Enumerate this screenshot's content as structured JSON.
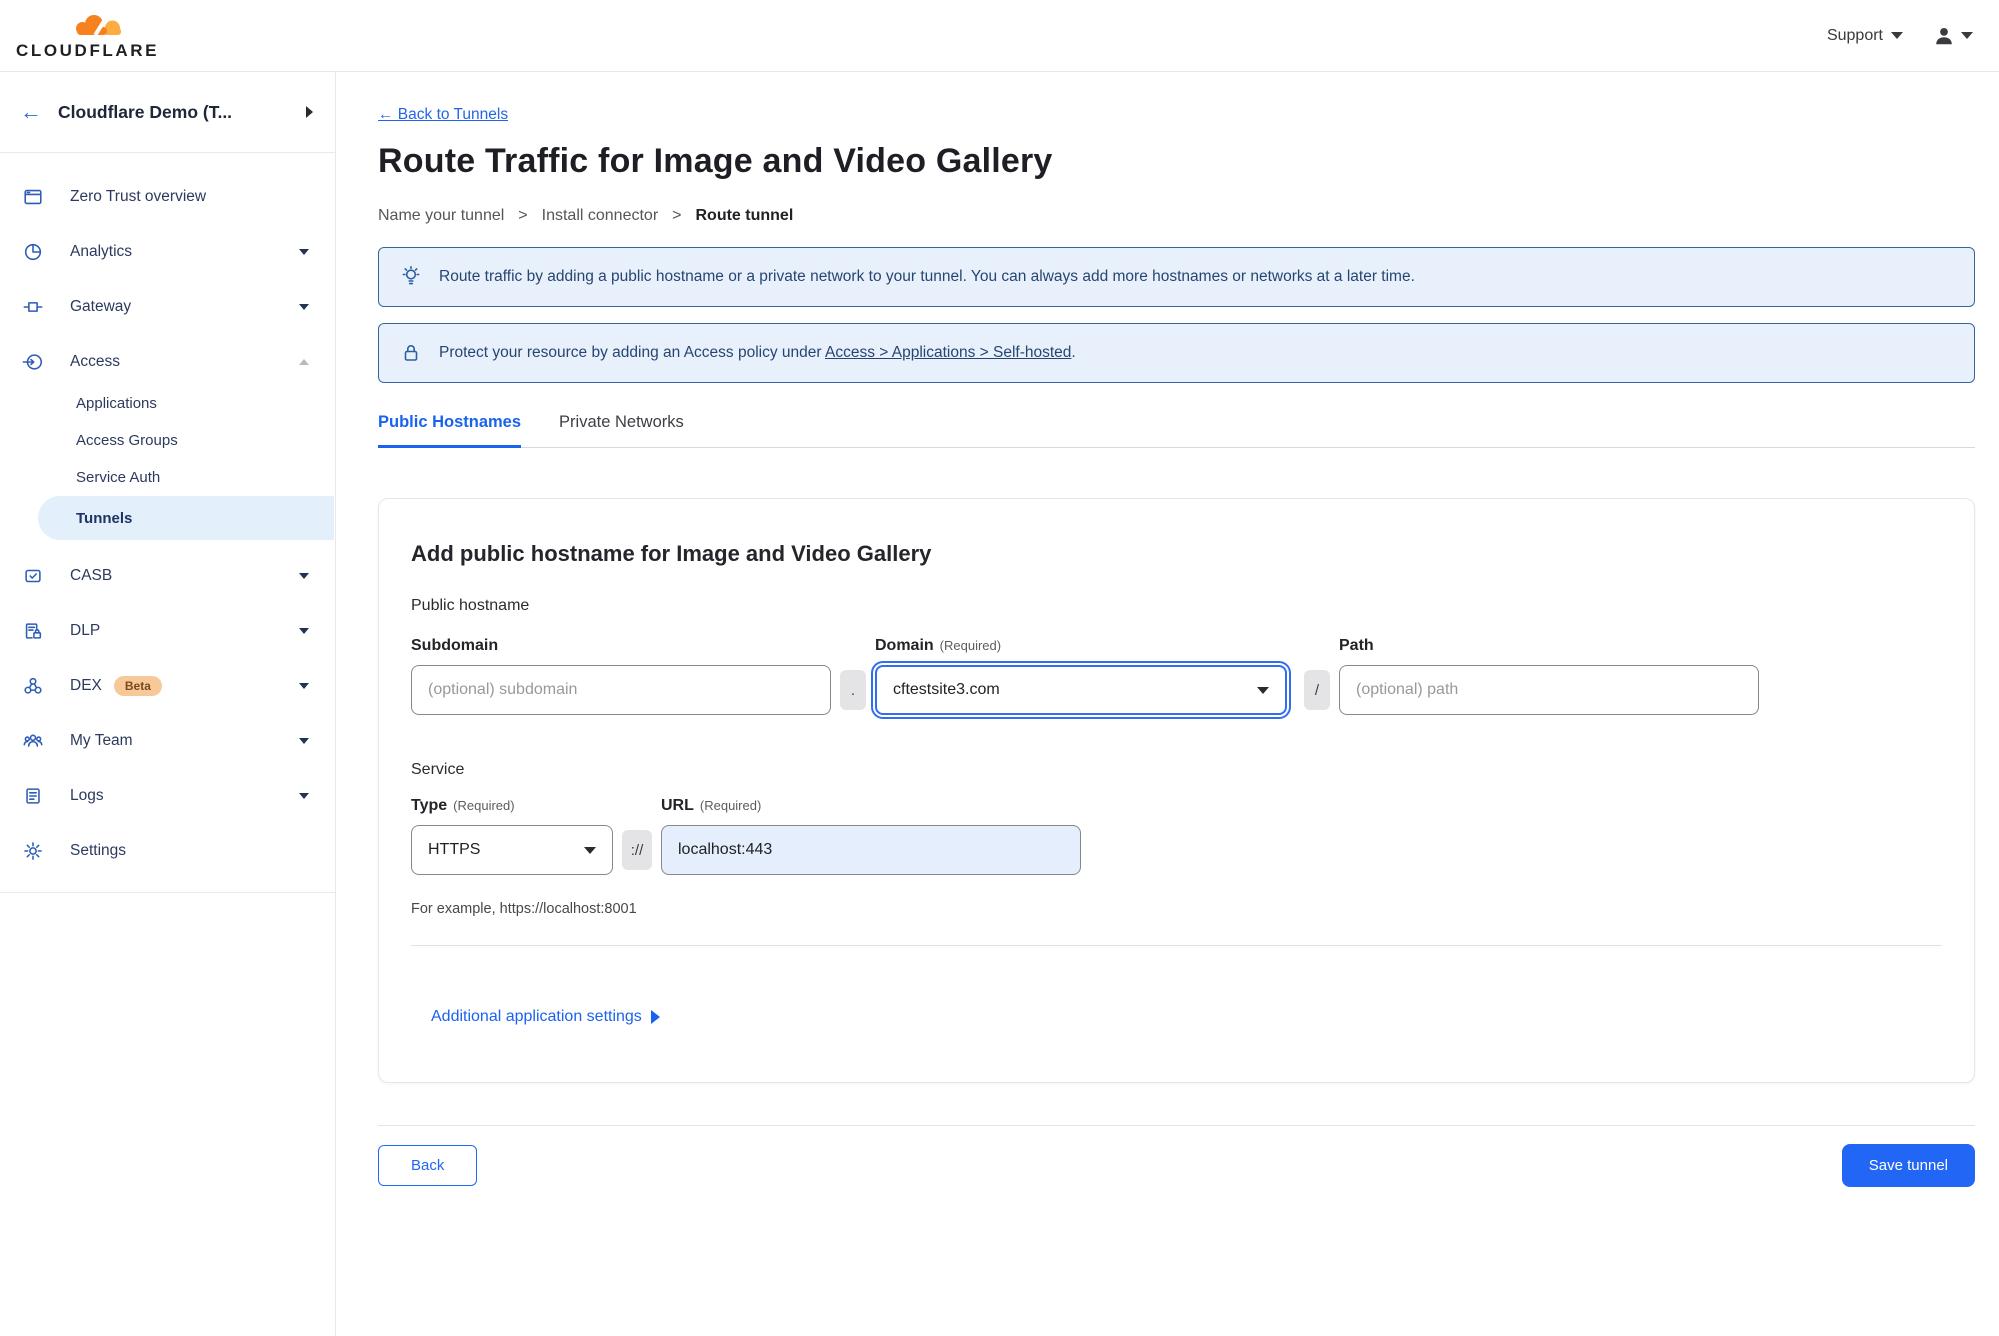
{
  "colors": {
    "accent_blue": "#2166f5",
    "brand_orange": "#f6821f",
    "brand_orange_light": "#fbad41",
    "banner_bg": "#e8f1fb",
    "banner_border": "#35659f",
    "selected_pill_bg": "#e4effc",
    "beta_badge_bg": "#f8c998"
  },
  "header": {
    "logo_text": "CLOUDFLARE",
    "support_label": "Support"
  },
  "sidebar": {
    "account_title": "Cloudflare Demo (T...",
    "back_arrow": "←",
    "items": [
      {
        "label": "Zero Trust overview"
      },
      {
        "label": "Analytics"
      },
      {
        "label": "Gateway"
      },
      {
        "label": "Access"
      },
      {
        "label": "CASB"
      },
      {
        "label": "DLP"
      },
      {
        "label": "DEX",
        "badge": "Beta"
      },
      {
        "label": "My Team"
      },
      {
        "label": "Logs"
      },
      {
        "label": "Settings"
      }
    ],
    "access_children": [
      {
        "label": "Applications"
      },
      {
        "label": "Access Groups"
      },
      {
        "label": "Service Auth"
      },
      {
        "label": "Tunnels"
      }
    ]
  },
  "page": {
    "back_link": "← Back to Tunnels",
    "title": "Route Traffic for Image and Video Gallery",
    "breadcrumb": [
      {
        "label": "Name your tunnel"
      },
      {
        "label": "Install connector"
      },
      {
        "label": "Route tunnel"
      }
    ],
    "breadcrumb_separator": ">",
    "banner_tip": "Route traffic by adding a public hostname or a private network to your tunnel. You can always add more hostnames or networks at a later time.",
    "banner_protect_prefix": "Protect your resource by adding an Access policy under",
    "banner_protect_link": "Access > Applications > Self-hosted",
    "banner_protect_suffix": ".",
    "tabs": [
      {
        "label": "Public Hostnames"
      },
      {
        "label": "Private Networks"
      }
    ]
  },
  "form": {
    "heading": "Add public hostname for Image and Video Gallery",
    "public_hostname_label": "Public hostname",
    "required_hint": "(Required)",
    "subdomain_label": "Subdomain",
    "subdomain_placeholder": "(optional) subdomain",
    "dot_separator": ".",
    "domain_label": "Domain",
    "domain_value": "cftestsite3.com",
    "slash_separator": "/",
    "path_label": "Path",
    "path_placeholder": "(optional) path",
    "service_label": "Service",
    "type_label": "Type",
    "type_value": "HTTPS",
    "scheme_separator": "://",
    "url_label": "URL",
    "url_value": "localhost:443",
    "example_text": "For example, https://localhost:8001",
    "additional_settings_label": "Additional application settings"
  },
  "footer": {
    "back_label": "Back",
    "save_label": "Save tunnel"
  }
}
